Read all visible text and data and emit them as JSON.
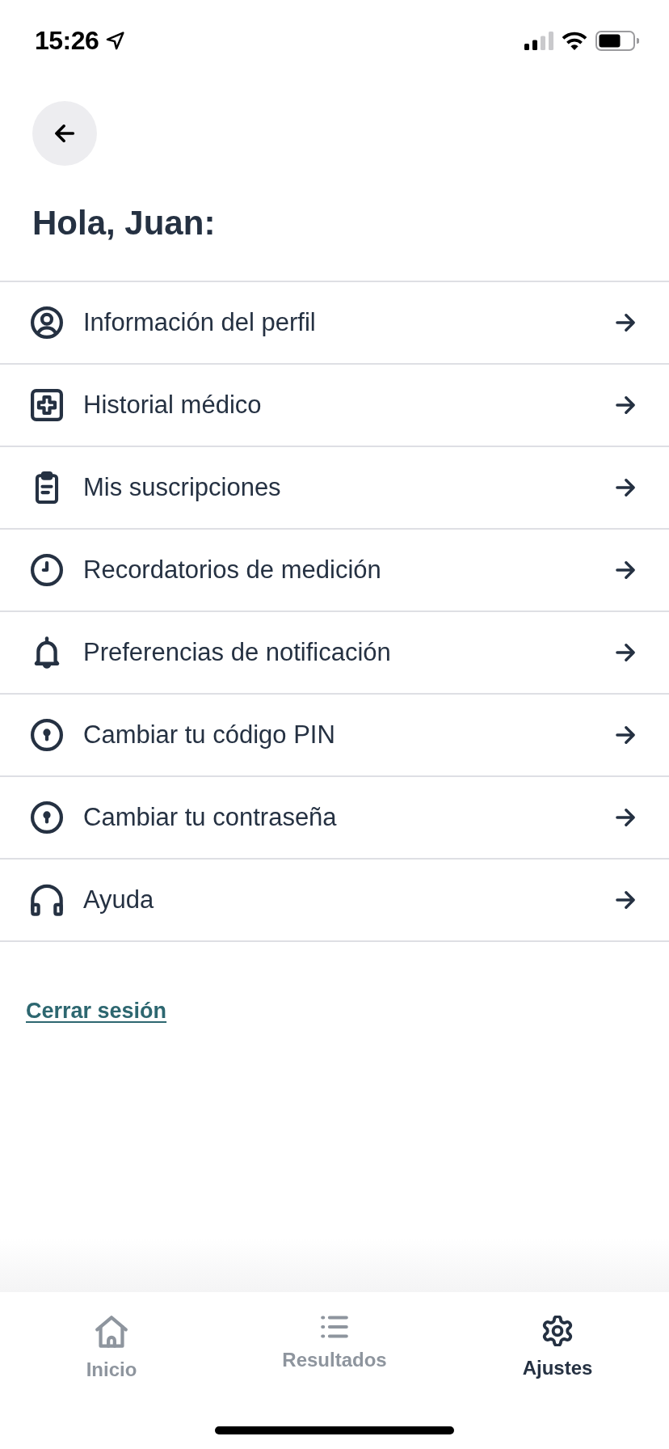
{
  "status_bar": {
    "time": "15:26"
  },
  "header": {
    "title": "Hola, Juan:"
  },
  "menu": [
    {
      "label": "Información del perfil"
    },
    {
      "label": "Historial médico"
    },
    {
      "label": "Mis suscripciones"
    },
    {
      "label": "Recordatorios de medición"
    },
    {
      "label": "Preferencias de notificación"
    },
    {
      "label": "Cambiar tu código PIN"
    },
    {
      "label": "Cambiar tu contraseña"
    },
    {
      "label": "Ayuda"
    }
  ],
  "logout_link": "Cerrar sesión",
  "tab_bar": [
    {
      "label": "Inicio",
      "selected": false
    },
    {
      "label": "Resultados",
      "selected": false
    },
    {
      "label": "Ajustes",
      "selected": true
    }
  ]
}
